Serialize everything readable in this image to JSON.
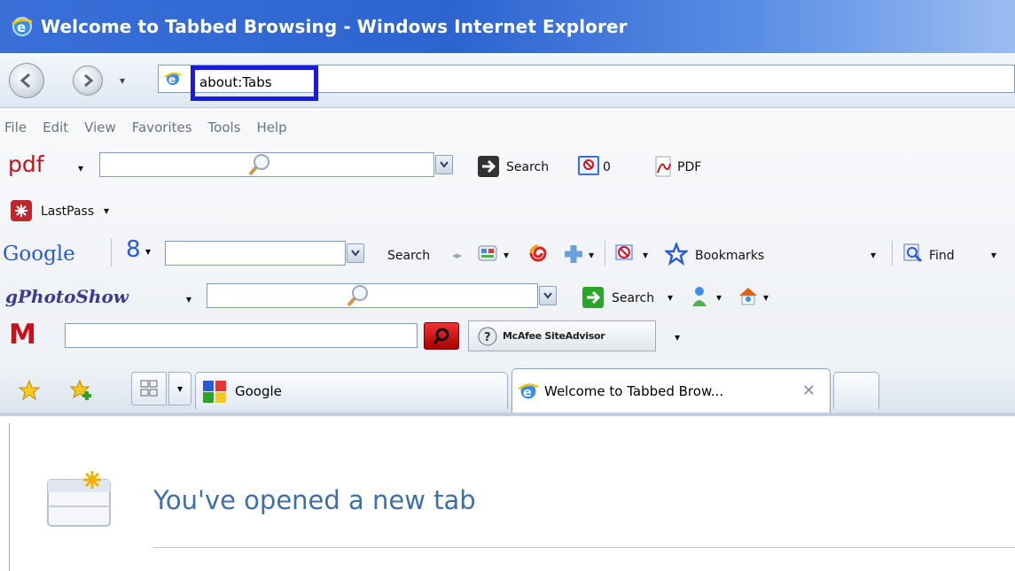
{
  "window": {
    "title": "Welcome to Tabbed Browsing - Windows Internet Explorer"
  },
  "address_bar": {
    "url": "about:Tabs"
  },
  "menu": [
    "File",
    "Edit",
    "View",
    "Favorites",
    "Tools",
    "Help"
  ],
  "toolbars": {
    "pdf": {
      "brand": "pdf",
      "search_label": "Search",
      "count": "0",
      "pdf_label": "PDF"
    },
    "lastpass": {
      "label": "LastPass"
    },
    "google": {
      "brand": "Google",
      "g_label": "8",
      "search_label": "Search",
      "bookmarks_label": "Bookmarks",
      "find_label": "Find"
    },
    "gphotoshow": {
      "brand": "gPhotoShow",
      "search_label": "Search"
    },
    "mcafee": {
      "brand": "M",
      "siteadvisor_label": "McAfee SiteAdvisor"
    }
  },
  "tabs": [
    {
      "label": "Google"
    },
    {
      "label": "Welcome to Tabbed Brow..."
    }
  ],
  "page": {
    "heading": "You've opened a new tab"
  },
  "colors": {
    "titlebar": "#2d64d0",
    "highlight": "#1a1adf",
    "heading": "#3d6fa8"
  }
}
